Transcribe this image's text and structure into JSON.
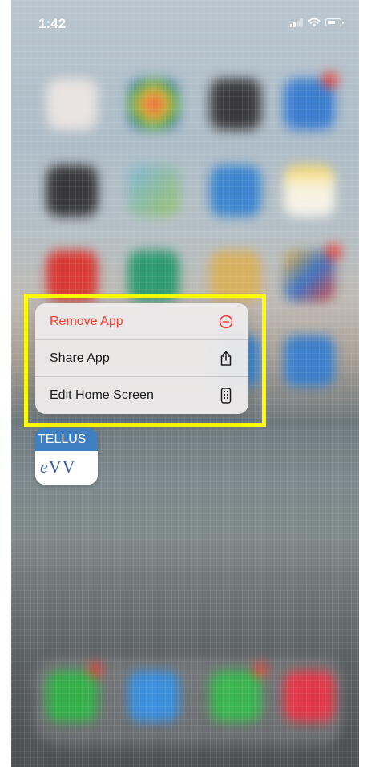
{
  "status_bar": {
    "time": "1:42",
    "icons": [
      "cellular-signal-icon",
      "wifi-icon",
      "battery-icon"
    ]
  },
  "context_menu": {
    "items": [
      {
        "label": "Remove App",
        "icon": "minus-circle-icon",
        "color": "#ff3b30"
      },
      {
        "label": "Share App",
        "icon": "share-icon",
        "color": "#1c1c1e"
      },
      {
        "label": "Edit Home Screen",
        "icon": "phone-screen-icon",
        "color": "#1c1c1e"
      }
    ],
    "highlight_color": "#ffff00"
  },
  "app_icon": {
    "top_text": "TELLUS",
    "bottom_text_e": "e",
    "bottom_text_rest": "VV",
    "top_color": "#3f7fc2"
  }
}
